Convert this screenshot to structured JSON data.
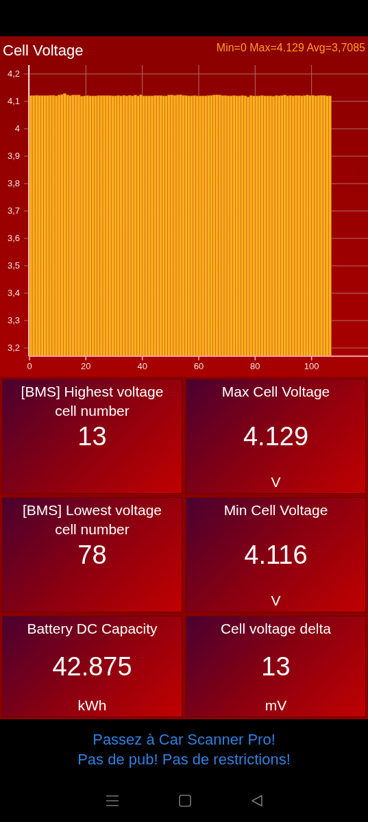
{
  "header": {
    "summary": "Min=0 Max=4.129 Avg=3,7085"
  },
  "chart": {
    "chart_data": {
      "type": "bar",
      "title": "Cell Voltage",
      "grid": true,
      "xlim": [
        0,
        120
      ],
      "ylim": [
        3.17,
        4.2325
      ],
      "x": [
        0,
        1,
        2,
        3,
        4,
        5,
        6,
        7,
        8,
        9,
        10,
        11,
        12,
        13,
        14,
        15,
        16,
        17,
        18,
        19,
        20,
        21,
        22,
        23,
        24,
        25,
        26,
        27,
        28,
        29,
        30,
        31,
        32,
        33,
        34,
        35,
        36,
        37,
        38,
        39,
        40,
        41,
        42,
        43,
        44,
        45,
        46,
        47,
        48,
        49,
        50,
        51,
        52,
        53,
        54,
        55,
        56,
        57,
        58,
        59,
        60,
        61,
        62,
        63,
        64,
        65,
        66,
        67,
        68,
        69,
        70,
        71,
        72,
        73,
        74,
        75,
        76,
        77,
        78,
        79,
        80,
        81,
        82,
        83,
        84,
        85,
        86,
        87,
        88,
        89,
        90,
        91,
        92,
        93,
        94,
        95,
        96,
        97,
        98,
        99,
        100,
        101,
        102,
        103,
        104,
        105,
        106
      ],
      "xticks": [
        0,
        20,
        40,
        60,
        80,
        100
      ],
      "yticks": [
        {
          "value": 3.2,
          "label": "3,2"
        },
        {
          "value": 3.3,
          "label": "3,3"
        },
        {
          "value": 3.4,
          "label": "3,4"
        },
        {
          "value": 3.5,
          "label": "3,5"
        },
        {
          "value": 3.6,
          "label": "3,6"
        },
        {
          "value": 3.7,
          "label": "3,7"
        },
        {
          "value": 3.8,
          "label": "3,8"
        },
        {
          "value": 3.9,
          "label": "3,9"
        },
        {
          "value": 4,
          "label": "4"
        },
        {
          "value": 4.1,
          "label": "4,1"
        },
        {
          "value": 4.2,
          "label": "4,2"
        }
      ],
      "series": [
        {
          "color": "#ffb020",
          "values": [
            4.121,
            4.121,
            4.122,
            4.121,
            4.121,
            4.121,
            4.121,
            4.122,
            4.122,
            4.12,
            4.123,
            4.125,
            4.129,
            4.123,
            4.121,
            4.123,
            4.123,
            4.123,
            4.119,
            4.12,
            4.121,
            4.12,
            4.12,
            4.12,
            4.121,
            4.121,
            4.121,
            4.121,
            4.121,
            4.12,
            4.12,
            4.121,
            4.12,
            4.122,
            4.12,
            4.122,
            4.12,
            4.123,
            4.12,
            4.124,
            4.12,
            4.12,
            4.12,
            4.12,
            4.121,
            4.121,
            4.121,
            4.12,
            4.12,
            4.123,
            4.123,
            4.122,
            4.123,
            4.124,
            4.122,
            4.121,
            4.12,
            4.12,
            4.121,
            4.12,
            4.12,
            4.12,
            4.12,
            4.121,
            4.122,
            4.123,
            4.124,
            4.123,
            4.121,
            4.121,
            4.12,
            4.12,
            4.121,
            4.12,
            4.12,
            4.121,
            4.12,
            4.116,
            4.121,
            4.12,
            4.12,
            4.12,
            4.121,
            4.12,
            4.12,
            4.12,
            4.119,
            4.121,
            4.12,
            4.121,
            4.123,
            4.12,
            4.121,
            4.12,
            4.121,
            4.121,
            4.12,
            4.121,
            4.123,
            4.121,
            4.122,
            4.12,
            4.121,
            4.122,
            4.122,
            4.12,
            4.12
          ]
        }
      ]
    }
  },
  "tiles": [
    {
      "title": "[BMS] Highest voltage cell number",
      "value": "13"
    },
    {
      "title": "Max Cell Voltage",
      "value": "4.129",
      "unit": "V"
    },
    {
      "title": "[BMS] Lowest voltage cell number",
      "value": "78"
    },
    {
      "title": "Min Cell Voltage",
      "value": "4.116",
      "unit": "V"
    },
    {
      "title": "Battery DC Capacity",
      "value": "42.875",
      "unit": "kWh"
    },
    {
      "title": "Cell voltage delta",
      "value": "13",
      "unit": "mV"
    }
  ],
  "ad": {
    "lines": [
      "Passez à Car Scanner Pro!",
      "Pas de pub! Pas de restrictions!"
    ]
  }
}
